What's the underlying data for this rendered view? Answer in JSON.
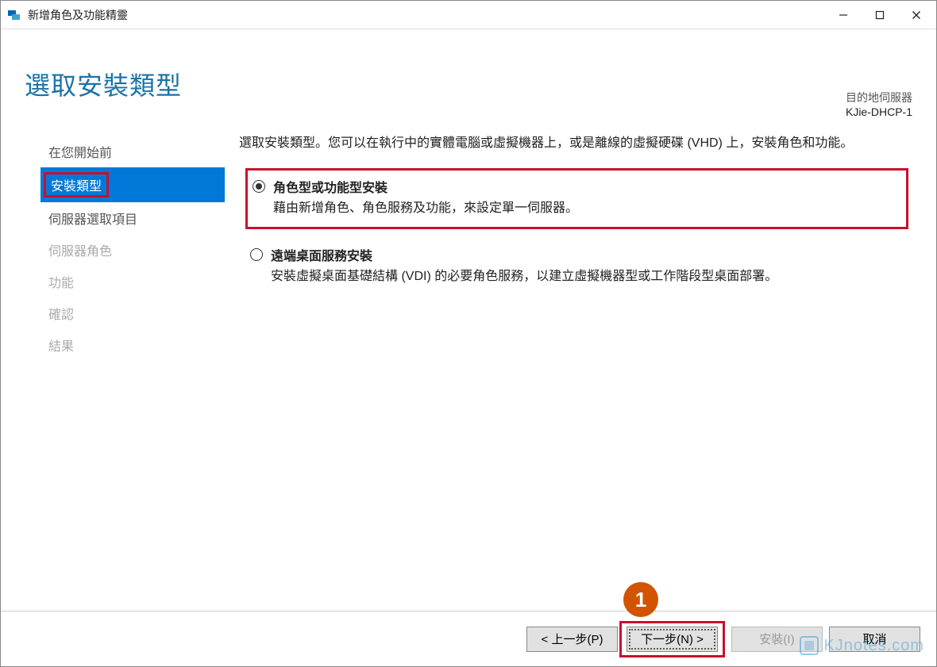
{
  "titlebar": {
    "title": "新增角色及功能精靈"
  },
  "header": {
    "page_title": "選取安裝類型",
    "dest_label": "目的地伺服器",
    "dest_name": "KJie-DHCP-1"
  },
  "sidebar": {
    "items": [
      {
        "label": "在您開始前",
        "state": "normal"
      },
      {
        "label": "安裝類型",
        "state": "active"
      },
      {
        "label": "伺服器選取項目",
        "state": "normal"
      },
      {
        "label": "伺服器角色",
        "state": "disabled"
      },
      {
        "label": "功能",
        "state": "disabled"
      },
      {
        "label": "確認",
        "state": "disabled"
      },
      {
        "label": "結果",
        "state": "disabled"
      }
    ]
  },
  "main": {
    "instruction": "選取安裝類型。您可以在執行中的實體電腦或虛擬機器上，或是離線的虛擬硬碟 (VHD) 上，安裝角色和功能。",
    "options": [
      {
        "title": "角色型或功能型安裝",
        "desc": "藉由新增角色、角色服務及功能，來設定單一伺服器。",
        "checked": true,
        "highlighted": true
      },
      {
        "title": "遠端桌面服務安裝",
        "desc": "安裝虛擬桌面基礎結構 (VDI) 的必要角色服務，以建立虛擬機器型或工作階段型桌面部署。",
        "checked": false,
        "highlighted": false
      }
    ]
  },
  "footer": {
    "prev": "< 上一步(P)",
    "next": "下一步(N) >",
    "install": "安裝(I)",
    "cancel": "取消",
    "step_badge": "1"
  },
  "watermark": "KJnotes.com"
}
